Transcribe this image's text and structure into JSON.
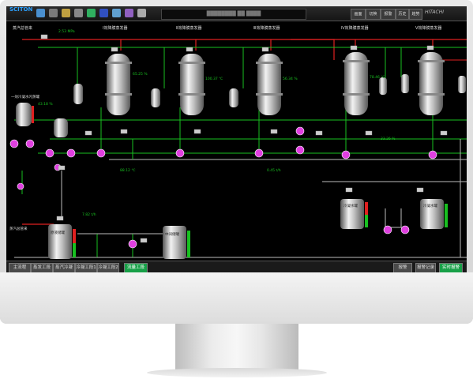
{
  "app": {
    "logo": "SCITON"
  },
  "header": {
    "title": "████████ ██ ████",
    "brand": "HITACHI"
  },
  "top_buttons": [
    "画面",
    "切换",
    "报警",
    "历史",
    "趋势"
  ],
  "units": [
    {
      "label": "Ⅰ效降膜蒸发器"
    },
    {
      "label": "Ⅱ效降膜蒸发器"
    },
    {
      "label": "Ⅲ效降膜蒸发器"
    },
    {
      "label": "Ⅳ效降膜蒸发器"
    },
    {
      "label": "Ⅴ效降膜蒸发器"
    }
  ],
  "labels": {
    "steam_in": "蒸汽总管来",
    "steam_in2": "蒸汽总管来",
    "flash_tank": "一效冷凝水闪蒸罐",
    "raw_tank": "原液储罐",
    "mid_tank": "中间储罐",
    "cond_tank1": "冷凝水罐",
    "cond_tank2": "冷凝水罐"
  },
  "readings": [
    "2.53 MPa",
    "65.25 %",
    "100.37 ℃",
    "56.34 %",
    "78.46 ℃",
    "43.18 %",
    "88.12 ℃",
    "0.45 t/h",
    "33.26 %",
    "7.82 t/h"
  ],
  "tabs": [
    {
      "label": "主流程"
    },
    {
      "label": "蒸发工段"
    },
    {
      "label": "蒸汽冷凝"
    },
    {
      "label": "冷凝工段1"
    },
    {
      "label": "冷凝工段2"
    },
    {
      "label": "流量工段"
    },
    {
      "label": "报警"
    },
    {
      "label": "报警记录"
    },
    {
      "label": "实时报警"
    }
  ],
  "colors": {
    "pipe_green": "#18c020",
    "pipe_red": "#e02020",
    "pump": "#e040e0",
    "accent": "#18a048"
  }
}
